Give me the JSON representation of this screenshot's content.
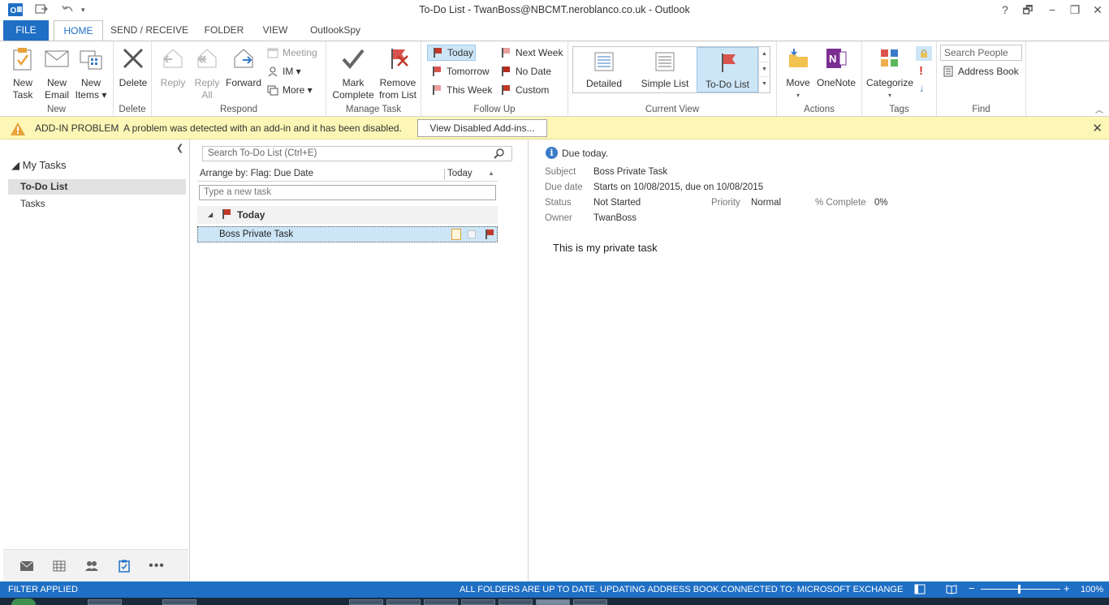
{
  "window": {
    "title": "To-Do List - TwanBoss@NBCMT.neroblanco.co.uk - Outlook",
    "help": "?",
    "restore": "🗗",
    "minimize": "−",
    "maximize": "❐",
    "close": "✕"
  },
  "tabs": [
    {
      "label": "FILE"
    },
    {
      "label": "HOME"
    },
    {
      "label": "SEND / RECEIVE"
    },
    {
      "label": "FOLDER"
    },
    {
      "label": "VIEW"
    },
    {
      "label": "OutlookSpy"
    }
  ],
  "ribbon": {
    "new": {
      "label": "New",
      "new_task": "New\nTask",
      "new_email": "New\nEmail",
      "new_items": "New\nItems ▾"
    },
    "delete": {
      "label": "Delete",
      "delete": "Delete"
    },
    "respond": {
      "label": "Respond",
      "reply": "Reply",
      "reply_all": "Reply\nAll",
      "forward": "Forward",
      "meeting": "Meeting",
      "im": "IM ▾",
      "more": "More ▾"
    },
    "manage": {
      "label": "Manage Task",
      "mark_complete": "Mark\nComplete",
      "remove": "Remove\nfrom List"
    },
    "followup": {
      "label": "Follow Up",
      "today": "Today",
      "tomorrow": "Tomorrow",
      "this_week": "This Week",
      "next_week": "Next Week",
      "no_date": "No Date",
      "custom": "Custom"
    },
    "view": {
      "label": "Current View",
      "detailed": "Detailed",
      "simple_list": "Simple List",
      "todo_list": "To-Do List"
    },
    "actions": {
      "label": "Actions",
      "move": "Move",
      "onenote": "OneNote"
    },
    "tags": {
      "label": "Tags",
      "categorize": "Categorize"
    },
    "find": {
      "label": "Find",
      "search_people": "Search People",
      "address_book": "Address Book"
    }
  },
  "infobar": {
    "label": "ADD-IN PROBLEM",
    "message": "A problem was detected with an add-in and it has been disabled.",
    "button": "View Disabled Add-ins...",
    "close": "✕"
  },
  "nav": {
    "collapse": "❮",
    "header": "◢ My Tasks",
    "items": [
      {
        "label": "To-Do List"
      },
      {
        "label": "Tasks"
      }
    ]
  },
  "tasklist": {
    "search_placeholder": "Search To-Do List (Ctrl+E)",
    "arrange_by": "Arrange by: Flag: Due Date",
    "arrange_order": "Today",
    "new_task_placeholder": "Type a new task",
    "group": "Today",
    "tasks": [
      {
        "name": "Boss Private Task"
      }
    ]
  },
  "reading": {
    "due_notice": "Due today.",
    "subject_label": "Subject",
    "subject": "Boss Private Task",
    "due_label": "Due date",
    "due": "Starts on 10/08/2015, due on 10/08/2015",
    "status_label": "Status",
    "status": "Not Started",
    "priority_label": "Priority",
    "priority": "Normal",
    "complete_label": "% Complete",
    "complete": "0%",
    "owner_label": "Owner",
    "owner": "TwanBoss",
    "body": "This is my private task"
  },
  "statusbar": {
    "filter": "FILTER APPLIED",
    "sync": "ALL FOLDERS ARE UP TO DATE.  UPDATING ADDRESS BOOK.",
    "connection": "CONNECTED TO: MICROSOFT EXCHANGE",
    "zoom": "100%",
    "zoom_minus": "−",
    "zoom_plus": "+"
  },
  "colors": {
    "accent": "#1f6fc5",
    "flag": "#c0392b",
    "selection": "#cde6f7",
    "infobar": "#fcf7b6"
  }
}
